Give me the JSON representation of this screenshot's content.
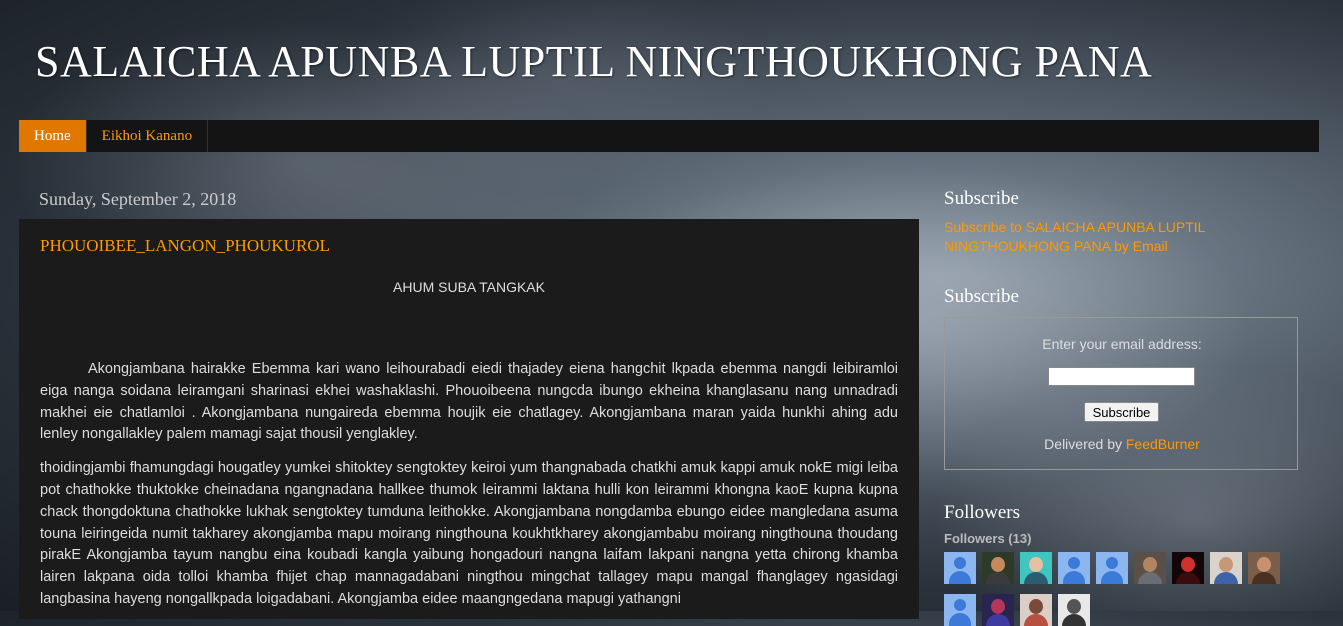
{
  "blog": {
    "title": "SALAICHA APUNBA LUPTIL NINGTHOUKHONG PANA"
  },
  "nav": {
    "tabs": [
      {
        "label": "Home",
        "active": true
      },
      {
        "label": "Eikhoi Kanano",
        "active": false
      }
    ]
  },
  "post": {
    "date": "Sunday, September 2, 2018",
    "title": "PHOUOIBEE_LANGON_PHOUKUROL",
    "heading": "AHUM SUBA TANGKAK",
    "paragraphs": [
      "Akongjambana hairakke Ebemma kari wano leihourabadi eiedi thajadey eiena hangchit lkpada ebemma nangdi leibiramloi eiga nanga soidana leiramgani sharinasi ekhei washaklashi. Phouoibeena nungcda ibungo ekheina khanglasanu nang unnadradi makhei eie chatlamloi . Akongjambana nungaireda ebemma houjik eie chatlagey. Akongjambana maran yaida hunkhi ahing adu lenley nongallakley palem mamagi sajat thousil yenglakley.",
      " thoidingjambi fhamungdagi hougatley yumkei shitoktey sengtoktey keiroi yum thangnabada chatkhi amuk kappi amuk nokE migi leiba pot chathokke thuktokke cheinadana ngangnadana hallkee thumok leirammi laktana hulli kon leirammi khongna kaoE kupna kupna chack thongdoktuna chathokke lukhak sengtoktey tumduna leithokke. Akongjambana nongdamba ebungo eidee mangledana asuma touna leiringeida numit takharey akongjamba mapu moirang ningthouna koukhtkharey  akongjambabu moirang ningthouna thoudang pirakE Akongjamba tayum nangbu eina koubadi kangla yaibung hongadouri nangna laifam lakpani nangna yetta chirong khamba lairen lakpana oida tolloi khamba fhijet chap mannagadabani ningthou mingchat tallagey mapu mangal fhanglagey ngasidagi langbasina hayeng nongallkpada loigadabani. Akongjamba eidee maangngedana mapugi yathangni"
    ]
  },
  "sidebar": {
    "subscribe1": {
      "heading": "Subscribe",
      "link": "Subscribe to SALAICHA APUNBA LUPTIL NINGTHOUKHONG PANA by Email"
    },
    "subscribe2": {
      "heading": "Subscribe",
      "label": "Enter your email address:",
      "email_value": "",
      "button": "Subscribe",
      "delivered_prefix": "Delivered by ",
      "delivered_link": "FeedBurner"
    },
    "followers": {
      "heading": "Followers",
      "count_label": "Followers (13)",
      "avatars": [
        {
          "kind": "default"
        },
        {
          "kind": "photo",
          "bg": "#2d3a2a",
          "head": "#c48a5c",
          "body": "#3b3b3b"
        },
        {
          "kind": "photo",
          "bg": "#3fc6c0",
          "head": "#e7c0a3",
          "body": "#2a5d70"
        },
        {
          "kind": "default"
        },
        {
          "kind": "default"
        },
        {
          "kind": "photo",
          "bg": "#5a5048",
          "head": "#b28461",
          "body": "#6b6d74"
        },
        {
          "kind": "photo",
          "bg": "#120608",
          "head": "#d0312f",
          "body": "#3a0c0e"
        },
        {
          "kind": "photo",
          "bg": "#d9d3cc",
          "head": "#c79878",
          "body": "#3f63a8"
        },
        {
          "kind": "photo",
          "bg": "#7a5e4a",
          "head": "#c8906c",
          "body": "#4a3020"
        },
        {
          "kind": "default"
        },
        {
          "kind": "photo",
          "bg": "#2a2450",
          "head": "#b4365a",
          "body": "#3e3aa0"
        },
        {
          "kind": "photo",
          "bg": "#d9cfc6",
          "head": "#7a4a3a",
          "body": "#b85040"
        },
        {
          "kind": "photo",
          "bg": "#e8e8e8",
          "head": "#555555",
          "body": "#333333"
        }
      ]
    }
  },
  "colors": {
    "accent": "#ff9900",
    "nav_active": "#e07800",
    "post_bg": "#1b1b1b"
  }
}
